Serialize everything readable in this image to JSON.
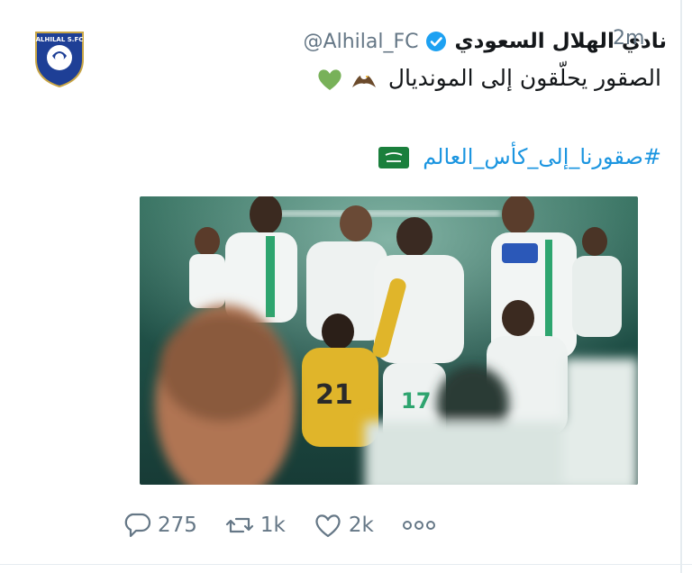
{
  "tweet": {
    "display_name": "نادي الهلال السعودي",
    "handle": "@Alhilal_FC",
    "time": "2m",
    "text": "الصقور يحلّقون إلى المونديال",
    "hashtag": "#صقورنا_إلى_كأس_العالم",
    "avatar_logo_text": "ALHILAL S.FC"
  },
  "actions": {
    "replies": "275",
    "retweets": "1k",
    "likes": "2k"
  },
  "icons": {
    "verified": "verified-badge-icon",
    "eagle": "eagle-emoji-icon",
    "heart": "green-heart-emoji-icon",
    "flag": "saudi-flag-emoji-icon",
    "reply": "reply-icon",
    "retweet": "retweet-icon",
    "like": "heart-icon",
    "more": "more-icon"
  },
  "colors": {
    "name": "#14171a",
    "secondary": "#657786",
    "link": "#1b95e0",
    "verified": "#1da1f2",
    "club_blue": "#1e3f96"
  }
}
